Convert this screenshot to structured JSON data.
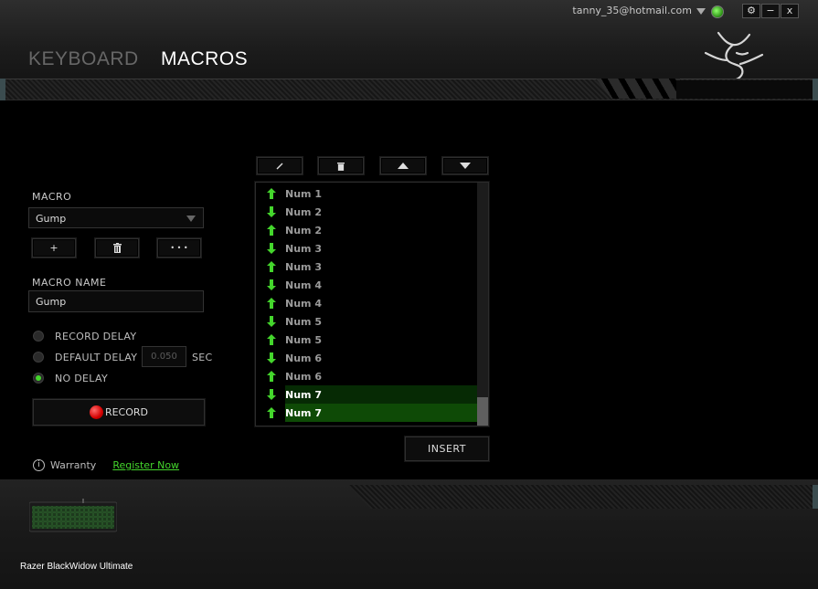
{
  "header": {
    "account_email": "tanny_35@hotmail.com",
    "settings_label": "⚙",
    "minimize_label": "−",
    "close_label": "x",
    "tabs": [
      {
        "label": "KEYBOARD",
        "active": false
      },
      {
        "label": "MACROS",
        "active": true
      }
    ],
    "accent_color": "#44d62c"
  },
  "macro_panel": {
    "macro_label": "MACRO",
    "selected_macro": "Gump",
    "add_label": "+",
    "delete_label": "🗑",
    "more_label": "• • •",
    "name_label": "MACRO NAME",
    "name_value": "Gump",
    "delay_options": [
      {
        "label": "RECORD DELAY",
        "selected": false
      },
      {
        "label": "DEFAULT DELAY",
        "selected": false
      },
      {
        "label": "NO DELAY",
        "selected": true
      }
    ],
    "default_delay_value": "0.050",
    "sec_label": "SEC",
    "record_label": "RECORD"
  },
  "event_list": {
    "items": [
      {
        "dir": "up",
        "label": "Num 1"
      },
      {
        "dir": "down",
        "label": "Num 2"
      },
      {
        "dir": "up",
        "label": "Num 2"
      },
      {
        "dir": "down",
        "label": "Num 3"
      },
      {
        "dir": "up",
        "label": "Num 3"
      },
      {
        "dir": "down",
        "label": "Num 4"
      },
      {
        "dir": "up",
        "label": "Num 4"
      },
      {
        "dir": "down",
        "label": "Num 5"
      },
      {
        "dir": "up",
        "label": "Num 5"
      },
      {
        "dir": "down",
        "label": "Num 6"
      },
      {
        "dir": "up",
        "label": "Num 6"
      },
      {
        "dir": "down",
        "label": "Num 7",
        "selected": true
      },
      {
        "dir": "up",
        "label": "Num 7",
        "selected": true,
        "active": true
      }
    ],
    "insert_label": "INSERT"
  },
  "footer": {
    "warranty_label": "Warranty",
    "register_label": "Register Now",
    "device_name": "Razer BlackWidow Ultimate"
  }
}
